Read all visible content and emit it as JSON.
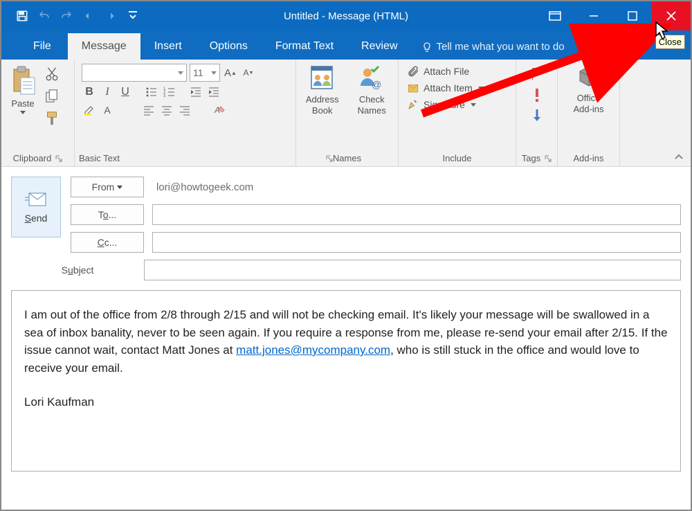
{
  "title": "Untitled  -  Message (HTML)",
  "tooltip": "Close",
  "tabs": {
    "file": "File",
    "message": "Message",
    "insert": "Insert",
    "options": "Options",
    "format_text": "Format Text",
    "review": "Review",
    "tell_me": "Tell me what you want to do"
  },
  "ribbon": {
    "clipboard": {
      "paste": "Paste",
      "label": "Clipboard"
    },
    "basic_text": {
      "font_size": "11",
      "label": "Basic Text"
    },
    "names": {
      "address_book": "Address Book",
      "check_names": "Check Names",
      "label": "Names"
    },
    "include": {
      "attach_file": "Attach File",
      "attach_item": "Attach Item",
      "signature": "Signature",
      "label": "Include"
    },
    "tags": {
      "label": "Tags"
    },
    "addins": {
      "office_addins": "Office Add-ins",
      "label": "Add-ins"
    }
  },
  "compose": {
    "from_label": "From",
    "from_value": "lori@howtogeek.com",
    "to_label": "To...",
    "cc_label": "Cc...",
    "subject_label": "Subject",
    "send": "Send"
  },
  "body": {
    "p1a": "I am out of the office from 2/8 through 2/15 and will not be checking email. It's likely your message will be swallowed in a sea of inbox banality, never to be seen again. If you require a response from me, please re-send your email after 2/15. If the issue cannot wait, contact Matt Jones at ",
    "link": "matt.jones@mycompany.com",
    "p1b": ", who is still stuck in the office and would love to receive your email.",
    "sig": "Lori Kaufman"
  }
}
